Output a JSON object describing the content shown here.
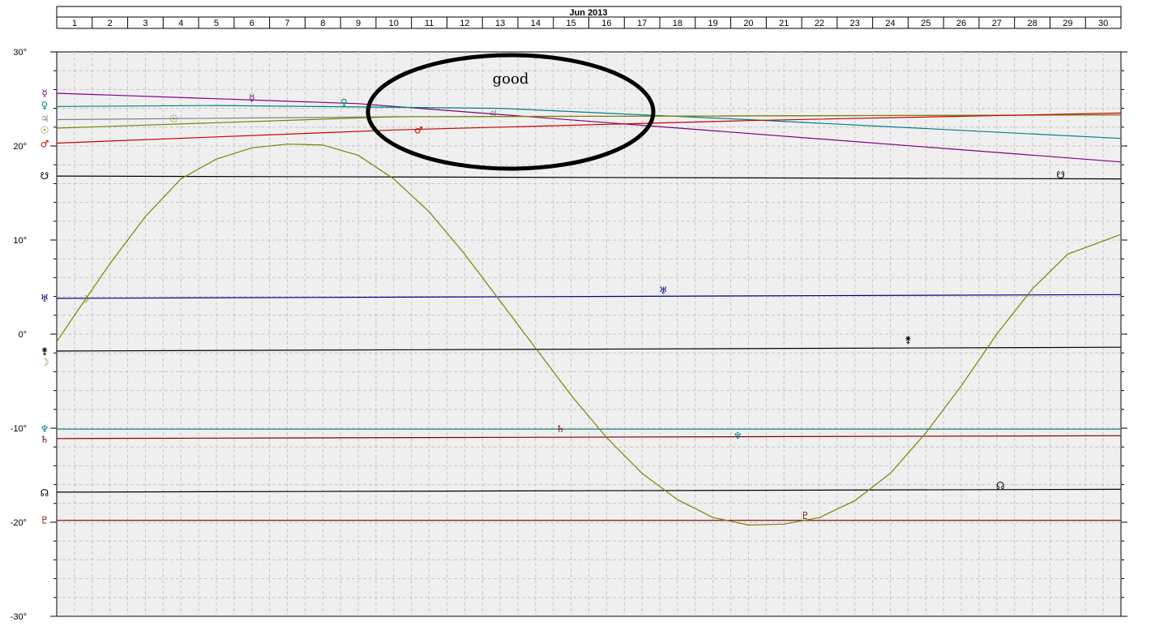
{
  "chart_data": {
    "type": "line",
    "title": "Jun 2013",
    "xlabel": "",
    "ylabel": "",
    "x": [
      1,
      2,
      3,
      4,
      5,
      6,
      7,
      8,
      9,
      10,
      11,
      12,
      13,
      14,
      15,
      16,
      17,
      18,
      19,
      20,
      21,
      22,
      23,
      24,
      25,
      26,
      27,
      28,
      29,
      30
    ],
    "xlim": [
      0.5,
      30.5
    ],
    "ylim": [
      -30,
      30
    ],
    "yticks": [
      30,
      20,
      10,
      0,
      -10,
      -20,
      -30
    ],
    "ytick_labels": [
      "30°",
      "20°",
      "10°",
      "0°",
      "-10°",
      "-20°",
      "-30°"
    ],
    "grid": true,
    "annotation": {
      "text": "good",
      "shape": "ellipse",
      "x_center": 13.2,
      "y_center": 23.0,
      "x_radius": 4.0,
      "y_radius": 6.1
    },
    "series": [
      {
        "glyph": "☿",
        "color": "#800080",
        "x": [
          0.5,
          9,
          30.5
        ],
        "values": [
          25.6,
          24.5,
          18.3
        ]
      },
      {
        "glyph": "♀",
        "color": "#008080",
        "x": [
          0.5,
          5,
          13,
          20,
          30.5
        ],
        "values": [
          24.2,
          24.3,
          24.0,
          22.8,
          20.8
        ]
      },
      {
        "glyph": "♃",
        "color": "#808080",
        "x": [
          0.5,
          10,
          30.5
        ],
        "values": [
          22.8,
          23.1,
          23.3
        ]
      },
      {
        "glyph": "☉",
        "color": "#808000",
        "x": [
          0.5,
          10,
          30.5
        ],
        "values": [
          21.9,
          23.1,
          23.3
        ]
      },
      {
        "glyph": "♂",
        "color": "#cc0000",
        "x": [
          0.5,
          10,
          20,
          30.5
        ],
        "values": [
          20.3,
          21.7,
          22.7,
          23.5
        ]
      },
      {
        "glyph": "☋",
        "color": "#000000",
        "x": [
          0.5,
          30.5
        ],
        "values": [
          16.8,
          16.5
        ]
      },
      {
        "glyph": "♅",
        "color": "#000080",
        "x": [
          0.5,
          30.5
        ],
        "values": [
          3.8,
          4.2
        ]
      },
      {
        "glyph": "⚵",
        "color": "#000000",
        "x": [
          0.5,
          30.5
        ],
        "values": [
          -1.8,
          -1.4
        ]
      },
      {
        "glyph": "♆",
        "color": "#008080",
        "x": [
          0.5,
          30.5
        ],
        "values": [
          -10.1,
          -10.1
        ]
      },
      {
        "glyph": "♄",
        "color": "#800000",
        "x": [
          0.5,
          30.5
        ],
        "values": [
          -11.1,
          -10.8
        ]
      },
      {
        "glyph": "☊",
        "color": "#000000",
        "x": [
          0.5,
          30.5
        ],
        "values": [
          -16.8,
          -16.5
        ]
      },
      {
        "glyph": "♇",
        "color": "#800000",
        "x": [
          0.5,
          30.5
        ],
        "values": [
          -19.8,
          -19.8
        ]
      },
      {
        "glyph": "☽",
        "color": "#808000",
        "x": [
          0.5,
          1,
          2,
          3,
          4,
          5,
          6,
          7,
          8,
          9,
          10,
          11,
          12,
          13,
          14,
          15,
          16,
          17,
          18,
          19,
          20,
          21,
          22,
          23,
          24,
          25,
          26,
          27,
          28,
          29,
          30,
          30.5
        ],
        "values": [
          -0.8,
          2.0,
          7.5,
          12.5,
          16.5,
          18.6,
          19.8,
          20.2,
          20.1,
          19.0,
          16.5,
          13.0,
          8.5,
          3.5,
          -1.5,
          -6.5,
          -11.0,
          -14.8,
          -17.6,
          -19.5,
          -20.3,
          -20.2,
          -19.5,
          -17.7,
          -14.8,
          -10.5,
          -5.5,
          0.0,
          4.8,
          8.5,
          9.9,
          10.6
        ]
      }
    ],
    "glyph_labels": [
      {
        "glyph": "☿",
        "x": 6.0,
        "y": 25.1
      },
      {
        "glyph": "♀",
        "x": 8.6,
        "y": 24.6
      },
      {
        "glyph": "♃",
        "x": 12.8,
        "y": 23.4
      },
      {
        "glyph": "☉",
        "x": 3.8,
        "y": 22.9
      },
      {
        "glyph": "♂",
        "x": 10.7,
        "y": 21.7
      },
      {
        "glyph": "☋",
        "x": 28.8,
        "y": 16.9
      },
      {
        "glyph": "♅",
        "x": 17.6,
        "y": 4.6
      },
      {
        "glyph": "☽",
        "x": 1.3,
        "y": 3.7
      },
      {
        "glyph": "⚵",
        "x": 24.5,
        "y": -0.6
      },
      {
        "glyph": "♄",
        "x": 14.7,
        "y": -10.1
      },
      {
        "glyph": "♆",
        "x": 19.7,
        "y": -10.8
      },
      {
        "glyph": "☊",
        "x": 27.1,
        "y": -16.1
      },
      {
        "glyph": "♇",
        "x": 21.6,
        "y": -19.3
      }
    ],
    "left_glyphs": [
      {
        "glyph": "☿",
        "y": 25.6,
        "color": "#800080"
      },
      {
        "glyph": "♀",
        "y": 24.3,
        "color": "#008080"
      },
      {
        "glyph": "♃",
        "y": 22.9,
        "color": "#808080"
      },
      {
        "glyph": "☉",
        "y": 21.7,
        "color": "#808000"
      },
      {
        "glyph": "♂",
        "y": 20.2,
        "color": "#cc0000"
      },
      {
        "glyph": "☋",
        "y": 16.8,
        "color": "#000000"
      },
      {
        "glyph": "♅",
        "y": 3.8,
        "color": "#000080"
      },
      {
        "glyph": "⚵",
        "y": -1.8,
        "color": "#000000"
      },
      {
        "glyph": "☽",
        "y": -3.0,
        "color": "#808000"
      },
      {
        "glyph": "♆",
        "y": -10.1,
        "color": "#008080"
      },
      {
        "glyph": "♄",
        "y": -11.2,
        "color": "#800000"
      },
      {
        "glyph": "☊",
        "y": -16.9,
        "color": "#000000"
      },
      {
        "glyph": "♇",
        "y": -19.8,
        "color": "#800000"
      }
    ]
  }
}
